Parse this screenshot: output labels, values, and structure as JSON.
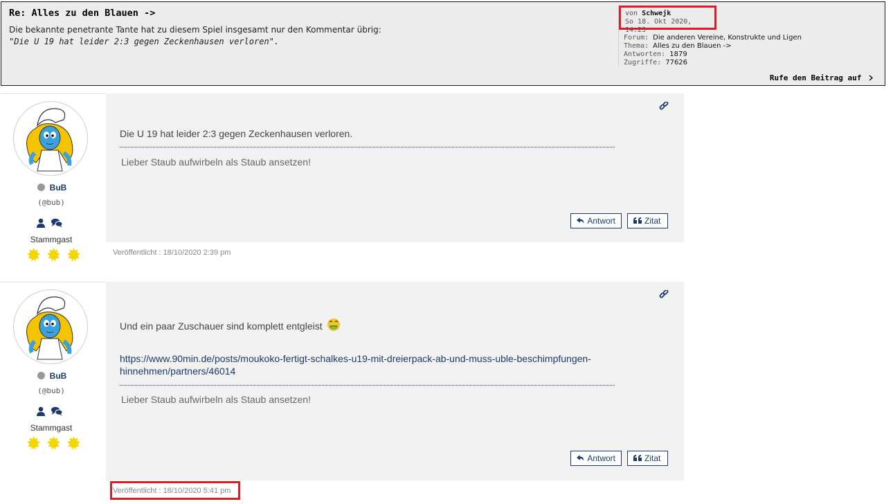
{
  "quote_box": {
    "title": "Re: Alles zu den Blauen ->",
    "body_line1": "Die bekannte penetrante Tante hat zu diesem Spiel insgesamt nur den Kommentar übrig:",
    "body_line2": "\"Die U 19 hat leider 2:3 gegen Zeckenhausen verloren\".",
    "author_prefix": "von",
    "author": "Schwejk",
    "date": "So 18. Okt 2020, 14:23",
    "forum_label": "Forum:",
    "forum_value": "Die anderen Vereine, Konstrukte und Ligen",
    "thread_label": "Thema:",
    "thread_value": "Alles zu den Blauen ->",
    "replies_label": "Antworten:",
    "replies_value": "1879",
    "views_label": "Zugriffe:",
    "views_value": "77626",
    "call_link": "Rufe den Beitrag auf",
    "call_icon": "chevron-right-icon",
    "highlight_color": "#d8202a"
  },
  "posts": [
    {
      "user": "BuB",
      "handle": "(@bub)",
      "rank": "Stammgast",
      "text": "Die U 19 hat leider 2:3 gegen Zeckenhausen verloren.",
      "signature": "Lieber Staub aufwirbeln als Staub ansetzen!",
      "reply_button": "Antwort",
      "quote_button": "Zitat",
      "published": "Veröffentlicht : 18/10/2020 2:39 pm",
      "star_count": 3
    },
    {
      "user": "BuB",
      "handle": "(@bub)",
      "rank": "Stammgast",
      "text": "Und ein paar Zuschauer sind komplett entgleist",
      "emoji": "🤮",
      "link_line1": "https://www.90min.de/posts/moukoko-fertigt-schalkes-u19-mit-dreierpack-ab-und-muss-uble-beschimpfungen-",
      "link_line2": "hinnehmen/partners/46014",
      "signature": "Lieber Staub aufwirbeln als Staub ansetzen!",
      "reply_button": "Antwort",
      "quote_button": "Zitat",
      "published": "Veröffentlicht : 18/10/2020 5:41 pm",
      "star_count": 3
    }
  ],
  "colors": {
    "accent": "#1b3a6b",
    "star": "#f2d600",
    "post_bg": "#f2f2f2"
  }
}
